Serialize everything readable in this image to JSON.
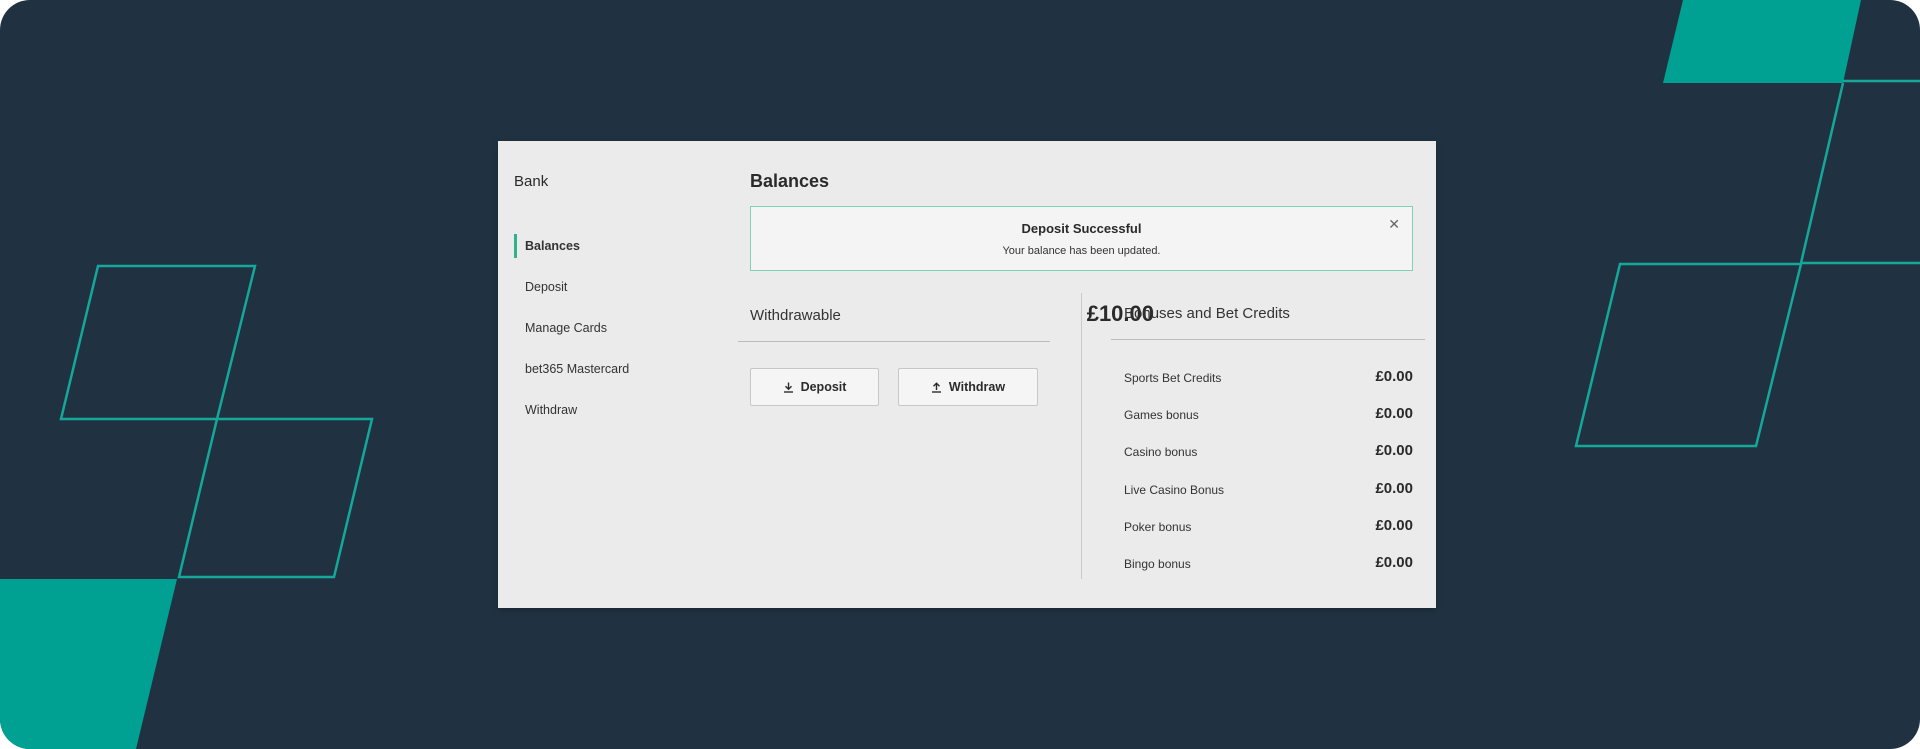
{
  "sidebar": {
    "title": "Bank",
    "items": [
      {
        "label": "Balances",
        "active": true
      },
      {
        "label": "Deposit",
        "active": false
      },
      {
        "label": "Manage Cards",
        "active": false
      },
      {
        "label": "bet365 Mastercard",
        "active": false
      },
      {
        "label": "Withdraw",
        "active": false
      }
    ]
  },
  "main": {
    "title": "Balances",
    "alert": {
      "title": "Deposit Successful",
      "message": "Your balance has been updated.",
      "close_icon": "close-icon"
    },
    "withdrawable": {
      "label": "Withdrawable",
      "amount": "£10.00"
    },
    "buttons": {
      "deposit_label": "Deposit",
      "deposit_icon": "download-icon",
      "withdraw_label": "Withdraw",
      "withdraw_icon": "upload-icon"
    },
    "bonuses": {
      "heading": "Bonuses and Bet Credits",
      "rows": [
        {
          "label": "Sports Bet Credits",
          "value": "£0.00"
        },
        {
          "label": "Games bonus",
          "value": "£0.00"
        },
        {
          "label": "Casino bonus",
          "value": "£0.00"
        },
        {
          "label": "Live Casino Bonus",
          "value": "£0.00"
        },
        {
          "label": "Poker bonus",
          "value": "£0.00"
        },
        {
          "label": "Bingo bonus",
          "value": "£0.00"
        }
      ]
    }
  },
  "theme": {
    "background": "#203241",
    "accent": "#00a093",
    "panel": "#eaebea",
    "success_border": "#7fd2b7"
  }
}
